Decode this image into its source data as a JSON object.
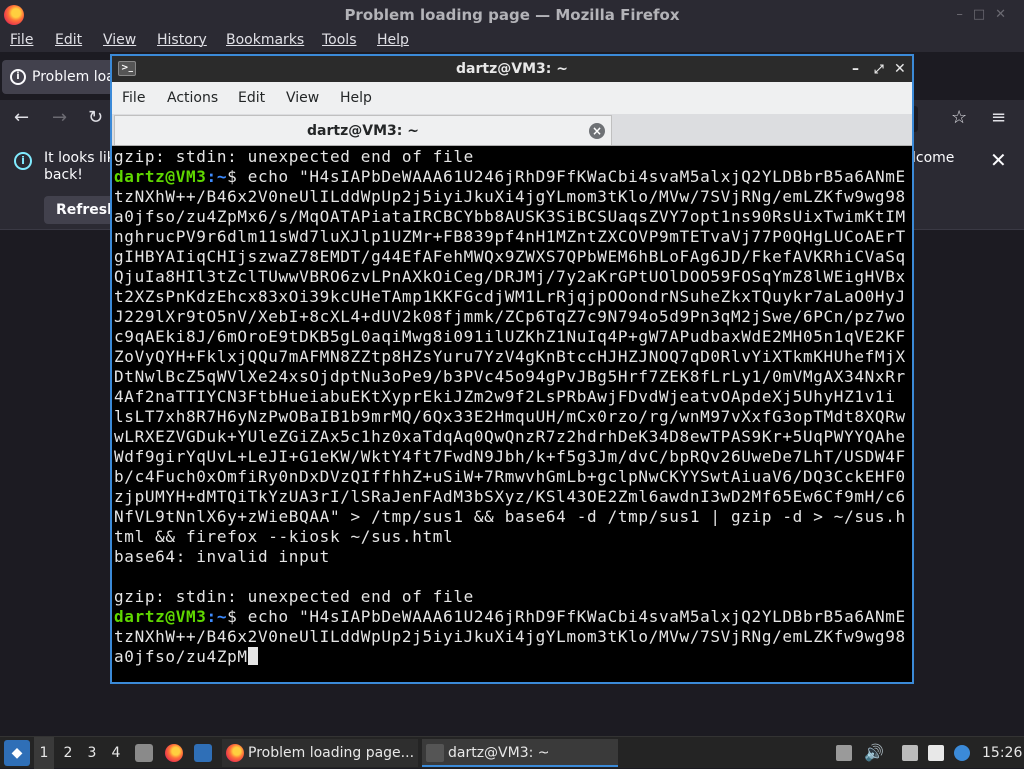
{
  "firefox": {
    "window_title": "Problem loading page — Mozilla Firefox",
    "menu": [
      "File",
      "Edit",
      "View",
      "History",
      "Bookmarks",
      "Tools",
      "Help"
    ],
    "tab_label": "Problem loa",
    "notice_text_line1": "It looks lik",
    "notice_text_line2": "back!",
    "notice_text_right": "lcome",
    "refresh_label": "Refresh"
  },
  "terminal": {
    "window_title": "dartz@VM3: ~",
    "menu": [
      "File",
      "Actions",
      "Edit",
      "View",
      "Help"
    ],
    "tab_label": "dartz@VM3: ~",
    "lines": [
      {
        "text": "gzip: stdin: unexpected end of file"
      },
      {
        "user": "dartz@VM3",
        "path": ":~",
        "text": "$ echo \"H4sIAPbDeWAAA61U246jRhD9FfKWaCbi4svaM5alxjQ2YLDBbrB5a6ANmE"
      },
      {
        "text": "tzNXhW++/B46x2V0neUlILddWpUp2j5iyiJkuXi4jgYLmom3tKlo/MVw/7SVjRNg/emLZKfw9wg98"
      },
      {
        "text": "a0jfso/zu4ZpMx6/s/MqOATAPiataIRCBCYbb8AUSK3SiBCSUaqsZVY7opt1ns90RsUixTwimKtIM"
      },
      {
        "text": "nghrucPV9r6dlm11sWd7luXJlp1UZMr+FB839pf4nH1MZntZXCOVP9mTETvaVj77P0QHgLUCoAErT"
      },
      {
        "text": "gIHBYAIiqCHIjszwaZ78EMDT/g44EfAFehMWQx9ZWXS7QPbWEM6hBLoFAg6JD/FkefAVKRhiCVaSq"
      },
      {
        "text": "QjuIa8HIl3tZclTUwwVBRO6zvLPnAXkOiCeg/DRJMj/7y2aKrGPtUOlDOO59FOSqYmZ8lWEigHVBx"
      },
      {
        "text": "t2XZsPnKdzEhcx83xOi39kcUHeTAmp1KKFGcdjWM1LrRjqjpOOondrNSuheZkxTQuykr7aLaO0HyJ"
      },
      {
        "text": "J229lXr9tO5nV/XebI+8cXL4+dUV2k08fjmmk/ZCp6TqZ7c9N794o5d9Pn3qM2jSwe/6PCn/pz7wo"
      },
      {
        "text": "c9qAEki8J/6mOroE9tDKB5gL0aqiMwg8i091ilUZKhZ1NuIq4P+gW7APudbaxWdE2MH05n1qVE2KF"
      },
      {
        "text": "ZoVyQYH+FklxjQQu7mAFMN8ZZtp8HZsYuru7YzV4gKnBtccHJHZJNOQ7qD0RlvYiXTkmKHUhefMjX"
      },
      {
        "text": "DtNwlBcZ5qWVlXe24xsOjdptNu3oPe9/b3PVc45o94gPvJBg5Hrf7ZEK8fLrLy1/0mVMgAX34NxRr"
      },
      {
        "text": "4Af2naTTIYCN3FtbHueiabuEKtXyprEkiJZm2w9f2LsPRbAwjFDvdWjeatvOApdeXj5UhyHZ1v1i"
      },
      {
        "text": "lsLT7xh8R7H6yNzPwOBaIB1b9mrMQ/6Qx33E2HmquUH/mCx0rzo/rg/wnM97vXxfG3opTMdt8XQRw"
      },
      {
        "text": "wLRXEZVGDuk+YUleZGiZAx5c1hz0xaTdqAq0QwQnzR7z2hdrhDeK34D8ewTPAS9Kr+5UqPWYYQAhe"
      },
      {
        "text": "Wdf9girYqUvL+LeJI+G1eKW/WktY4ft7FwdN9Jbh/k+f5g3Jm/dvC/bpRQv26UweDe7LhT/USDW4F"
      },
      {
        "text": "b/c4Fuch0xOmfiRy0nDxDVzQIffhhZ+uSiW+7RmwvhGmLb+gclpNwCKYYSwtAiuaV6/DQ3CckEHF0"
      },
      {
        "text": "zjpUMYH+dMTQiTkYzUA3rI/lSRaJenFAdM3bSXyz/KSl43OE2Zml6awdnI3wD2Mf65Ew6Cf9mH/c6"
      },
      {
        "text": "NfVL9tNnlX6y+zWieBQAA\" > /tmp/sus1 && base64 -d /tmp/sus1 | gzip -d > ~/sus.h"
      },
      {
        "text": "tml && firefox --kiosk ~/sus.html"
      },
      {
        "text": "base64: invalid input"
      },
      {
        "text": ""
      },
      {
        "text": "gzip: stdin: unexpected end of file"
      },
      {
        "user": "dartz@VM3",
        "path": ":~",
        "text": "$ echo \"H4sIAPbDeWAAA61U246jRhD9FfKWaCbi4svaM5alxjQ2YLDBbrB5a6ANmE"
      },
      {
        "text": "tzNXhW++/B46x2V0neUlILddWpUp2j5iyiJkuXi4jgYLmom3tKlo/MVw/7SVjRNg/emLZKfw9wg98"
      },
      {
        "text": "a0jfso/zu4ZpM",
        "cursor": true
      }
    ]
  },
  "taskbar": {
    "workspaces": [
      "1",
      "2",
      "3",
      "4"
    ],
    "tasks": [
      {
        "label": "Problem loading page...",
        "icon": "firefox-icon"
      },
      {
        "label": "dartz@VM3: ~",
        "icon": "terminal-icon"
      }
    ],
    "clock": "15:26"
  },
  "colors": {
    "prompt_user": "#5fd700",
    "prompt_path": "#3d8bff",
    "terminal_border": "#3b8ad8"
  }
}
